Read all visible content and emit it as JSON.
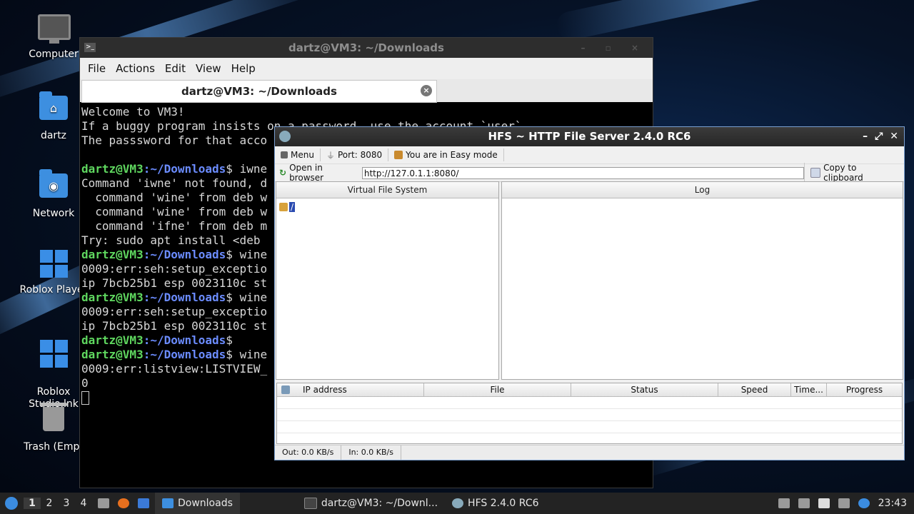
{
  "desktop": {
    "icons": [
      {
        "label": "Computer"
      },
      {
        "label": "dartz"
      },
      {
        "label": "Network"
      },
      {
        "label": "Roblox Player"
      },
      {
        "label": "Roblox\nStudio.lnk"
      },
      {
        "label": "Trash (Empt"
      }
    ]
  },
  "terminal": {
    "title": "dartz@VM3: ~/Downloads",
    "menu": [
      "File",
      "Actions",
      "Edit",
      "View",
      "Help"
    ],
    "tab_title": "dartz@VM3: ~/Downloads",
    "lines": [
      "Welcome to VM3!",
      "If a buggy program insists on a password, use the account `user`",
      "The passsword for that acco",
      "",
      {
        "user": "dartz@VM3",
        "path": ":~/Downloads",
        "cmd": "$ iwne"
      },
      "Command 'iwne' not found, d",
      "  command 'wine' from deb w",
      "  command 'wine' from deb w",
      "  command 'ifne' from deb m",
      "Try: sudo apt install <deb ",
      {
        "user": "dartz@VM3",
        "path": ":~/Downloads",
        "cmd": "$ wine"
      },
      "0009:err:seh:setup_exceptio",
      "ip 7bcb25b1 esp 0023110c st",
      {
        "user": "dartz@VM3",
        "path": ":~/Downloads",
        "cmd": "$ wine"
      },
      "0009:err:seh:setup_exceptio",
      "ip 7bcb25b1 esp 0023110c st",
      {
        "user": "dartz@VM3",
        "path": ":~/Downloads",
        "cmd": "$"
      },
      {
        "user": "dartz@VM3",
        "path": ":~/Downloads",
        "cmd": "$ wine"
      },
      "0009:err:listview:LISTVIEW_",
      "0"
    ]
  },
  "hfs": {
    "title": "HFS ~ HTTP File Server 2.4.0 RC6",
    "menu_label": "Menu",
    "port_label": "Port: 8080",
    "mode_label": "You are in Easy mode",
    "open_browser_label": "Open in browser",
    "url": "http://127.0.1.1:8080/",
    "copy_label": "Copy to clipboard",
    "vfs_header": "Virtual File System",
    "vfs_root": "/",
    "log_header": "Log",
    "columns": [
      "IP address",
      "File",
      "Status",
      "Speed",
      "Time...",
      "Progress"
    ],
    "status_out": "Out: 0.0 KB/s",
    "status_in": "In: 0.0 KB/s"
  },
  "taskbar": {
    "workspaces": [
      "1",
      "2",
      "3",
      "4"
    ],
    "tasks": [
      {
        "label": "Downloads",
        "icon": "folder-icon"
      },
      {
        "label": "dartz@VM3: ~/Downl...",
        "icon": "terminal-icon"
      },
      {
        "label": "HFS 2.4.0 RC6",
        "icon": "hfs-icon"
      }
    ],
    "clock": "23:43"
  },
  "colors": {
    "prompt_user": "#5fd75f",
    "prompt_path": "#6b8cff",
    "accent": "#3b8ce0"
  }
}
